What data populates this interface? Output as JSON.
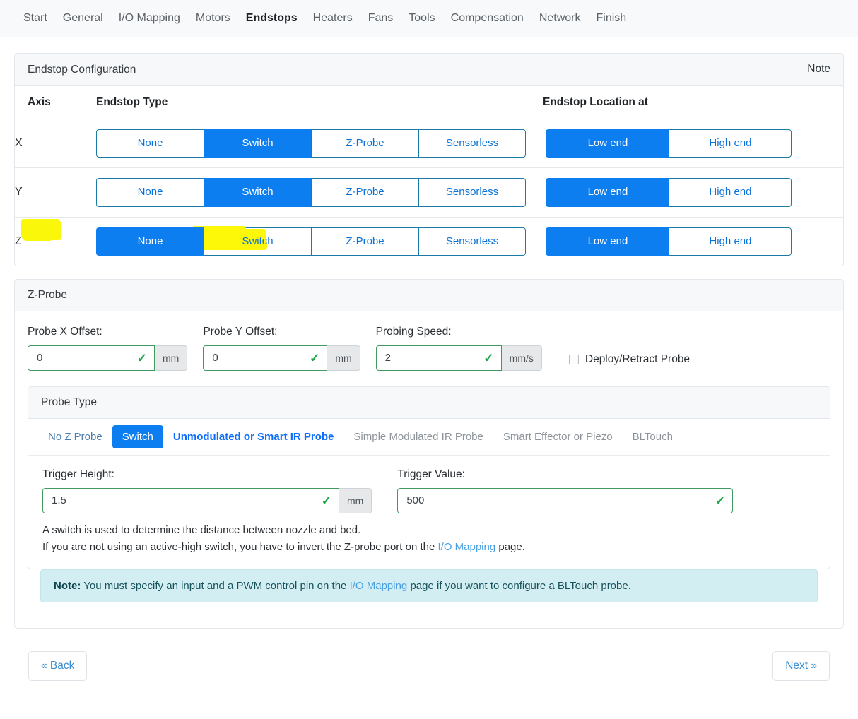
{
  "nav": {
    "items": [
      {
        "label": "Start",
        "active": false
      },
      {
        "label": "General",
        "active": false
      },
      {
        "label": "I/O Mapping",
        "active": false
      },
      {
        "label": "Motors",
        "active": false
      },
      {
        "label": "Endstops",
        "active": true
      },
      {
        "label": "Heaters",
        "active": false
      },
      {
        "label": "Fans",
        "active": false
      },
      {
        "label": "Tools",
        "active": false
      },
      {
        "label": "Compensation",
        "active": false
      },
      {
        "label": "Network",
        "active": false
      },
      {
        "label": "Finish",
        "active": false
      }
    ]
  },
  "endstop_card": {
    "title": "Endstop Configuration",
    "note_link": "Note",
    "columns": {
      "axis": "Axis",
      "type": "Endstop Type",
      "location": "Endstop Location at"
    },
    "type_options": [
      "None",
      "Switch",
      "Z-Probe",
      "Sensorless"
    ],
    "location_options": [
      "Low end",
      "High end"
    ],
    "rows": [
      {
        "axis": "X",
        "type_selected": "Switch",
        "location_selected": "Low end",
        "highlight_axis": false,
        "highlight_switch": false
      },
      {
        "axis": "Y",
        "type_selected": "Switch",
        "location_selected": "Low end",
        "highlight_axis": false,
        "highlight_switch": false
      },
      {
        "axis": "Z",
        "type_selected": "None",
        "location_selected": "Low end",
        "highlight_axis": true,
        "highlight_switch": true
      }
    ]
  },
  "zprobe_card": {
    "title": "Z-Probe",
    "probe_x_offset": {
      "label": "Probe X Offset:",
      "value": "0",
      "unit": "mm"
    },
    "probe_y_offset": {
      "label": "Probe Y Offset:",
      "value": "0",
      "unit": "mm"
    },
    "probing_speed": {
      "label": "Probing Speed:",
      "value": "2",
      "unit": "mm/s"
    },
    "deploy_retract": {
      "label": "Deploy/Retract Probe",
      "checked": false
    },
    "probe_type": {
      "title": "Probe Type",
      "tabs": [
        {
          "label": "No Z Probe",
          "state": "link"
        },
        {
          "label": "Switch",
          "state": "active"
        },
        {
          "label": "Unmodulated or Smart IR Probe",
          "state": "boldblue"
        },
        {
          "label": "Simple Modulated IR Probe",
          "state": "muted"
        },
        {
          "label": "Smart Effector or Piezo",
          "state": "muted"
        },
        {
          "label": "BLTouch",
          "state": "muted"
        }
      ],
      "trigger_height": {
        "label": "Trigger Height:",
        "value": "1.5",
        "unit": "mm"
      },
      "trigger_value": {
        "label": "Trigger Value:",
        "value": "500"
      },
      "description_line1": "A switch is used to determine the distance between nozzle and bed.",
      "description_line2_a": "If you are not using an active-high switch, you have to invert the Z-probe port on the ",
      "description_line2_link": "I/O Mapping",
      "description_line2_b": " page."
    },
    "alert": {
      "bold": "Note:",
      "text_a": " You must specify an input and a PWM control pin on the ",
      "link": "I/O Mapping",
      "text_b": " page if you want to configure a BLTouch probe."
    }
  },
  "footer": {
    "back_label": "« Back",
    "next_label": "Next »"
  },
  "colors": {
    "primary_blue": "#0d7ef0",
    "highlight_yellow": "#fcf808",
    "valid_green": "#3f9b62",
    "note_bg": "#d3eef2"
  }
}
